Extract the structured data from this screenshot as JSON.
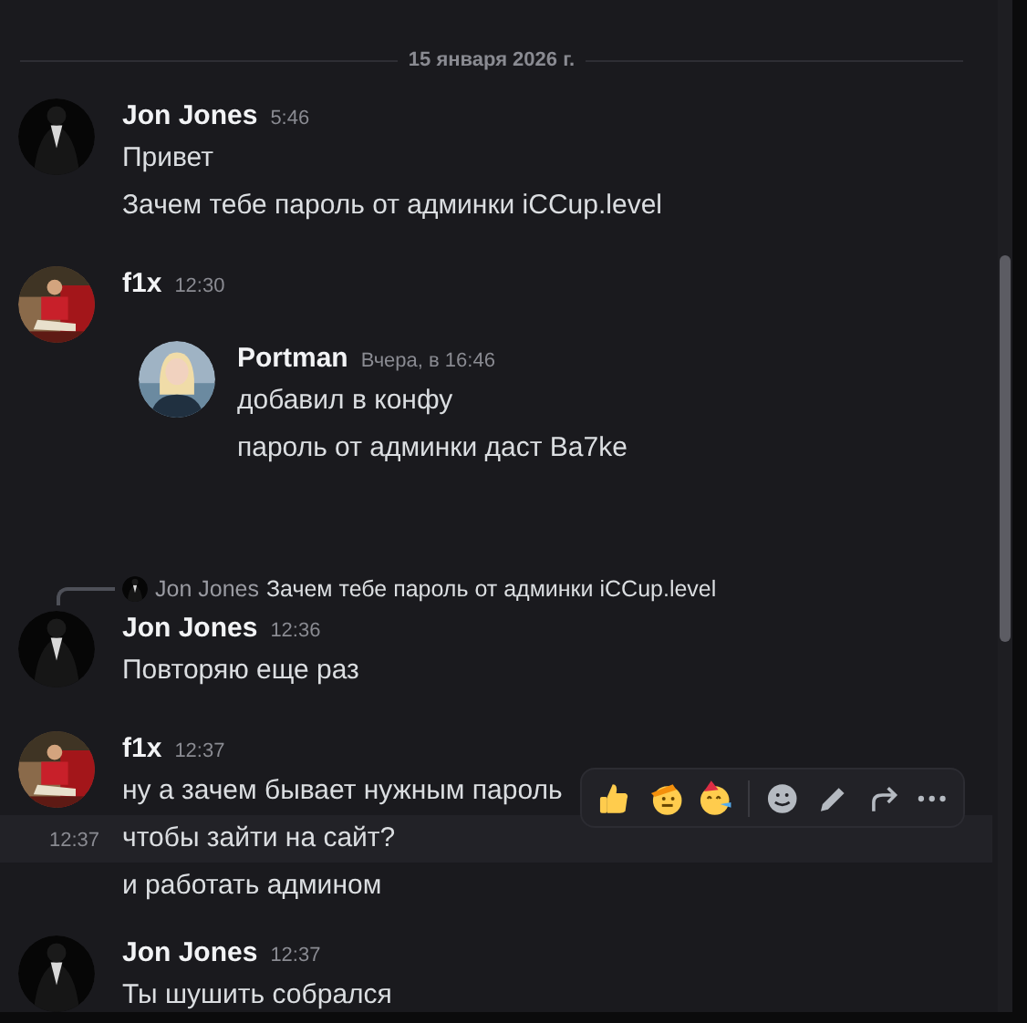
{
  "date_divider": "15 января 2026 г.",
  "messages": [
    {
      "author": "Jon Jones",
      "time": "5:46",
      "lines": [
        {
          "text": "Привет",
          "hovered": false
        },
        {
          "text": "Зачем тебе пароль от админки iCCup.level",
          "hovered": false
        }
      ]
    },
    {
      "author": "f1x",
      "time": "12:30",
      "forwarded": [
        {
          "author": "Portman",
          "time": "Вчера, в 16:46",
          "lines": [
            {
              "text": "добавил в конфу"
            },
            {
              "text": "пароль от админки даст Ba7ke"
            }
          ]
        }
      ]
    },
    {
      "author": "Jon Jones",
      "time": "12:36",
      "reply": {
        "author": "Jon Jones",
        "text": "Зачем тебе пароль от админки iCCup.level"
      },
      "lines": [
        {
          "text": "Повторяю еще раз",
          "hovered": false
        }
      ]
    },
    {
      "author": "f1x",
      "time": "12:37",
      "lines": [
        {
          "text": "ну а зачем бывает нужным пароль",
          "hovered": false
        },
        {
          "text": "чтобы зайти на сайт?",
          "hovered": true,
          "hover_time": "12:37"
        },
        {
          "text": "и работать админом",
          "hovered": false
        }
      ]
    },
    {
      "author": "Jon Jones",
      "time": "12:37",
      "lines": [
        {
          "text": "Ты шушить собрался",
          "hovered": false
        }
      ]
    }
  ]
}
